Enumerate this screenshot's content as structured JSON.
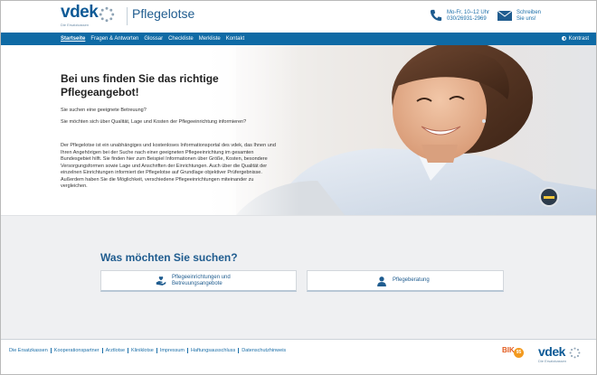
{
  "header": {
    "logo_text": "vdek",
    "logo_sub": "Die Ersatzkassen",
    "brand": "Pflegelotse",
    "phone_line1": "Mo-Fr, 10–12 Uhr",
    "phone_line2": "030/26931-2969",
    "mail_line1": "Schreiben",
    "mail_line2": "Sie uns!"
  },
  "nav": {
    "items": [
      "Startseite",
      "Fragen & Antworten",
      "Glossar",
      "Checkliste",
      "Merkliste",
      "Kontakt"
    ],
    "kontrast": "Kontrast"
  },
  "hero": {
    "title": "Bei uns finden Sie das richtige Pflegeangebot!",
    "q1": "Sie suchen eine geeignete Betreuung?",
    "q2": "Sie möchten sich über Qualität, Lage und Kosten der Pflegeeinrichtung informieren?",
    "body": "Der Pflegelotse ist ein unabhängiges und kostenloses Informationsportal des vdek, das Ihnen und Ihren Angehörigen bei der Suche nach einer geeigneten Pflegeeinrichtung im gesamten Bundesgebiet hilft. Sie finden hier zum Beispiel Informationen über Größe, Kosten, besondere Versorgungsformen sowie Lage und Anschriften der Einrichtungen. Auch über die Qualität der einzelnen Einrichtungen informiert der Pflegelotse auf Grundlage objektiver Prüfergebnisse. Außerdem haben Sie die Möglichkeit, verschiedene Pflegeeinrichtungen miteinander zu vergleichen."
  },
  "search": {
    "title": "Was möchten Sie suchen?",
    "option1_line1": "Pflegeeinrichtungen und",
    "option1_line2": "Betreuungsangebote",
    "option2": "Pflegeberatung"
  },
  "footer": {
    "links": [
      "Die Ersatzkassen",
      "Kooperationspartner",
      "Arztlotse",
      "Kliniklotse",
      "Impressum",
      "Haftungsausschluss",
      "Datenschutzhinweis"
    ],
    "bik": "BIK",
    "bik_badge": "95",
    "logo_text": "vdek",
    "logo_sub": "Die Ersatzkassen"
  },
  "colors": {
    "primary": "#0e6aa5",
    "brand_text": "#1f5c8f",
    "search_bg": "#eff0f2"
  }
}
